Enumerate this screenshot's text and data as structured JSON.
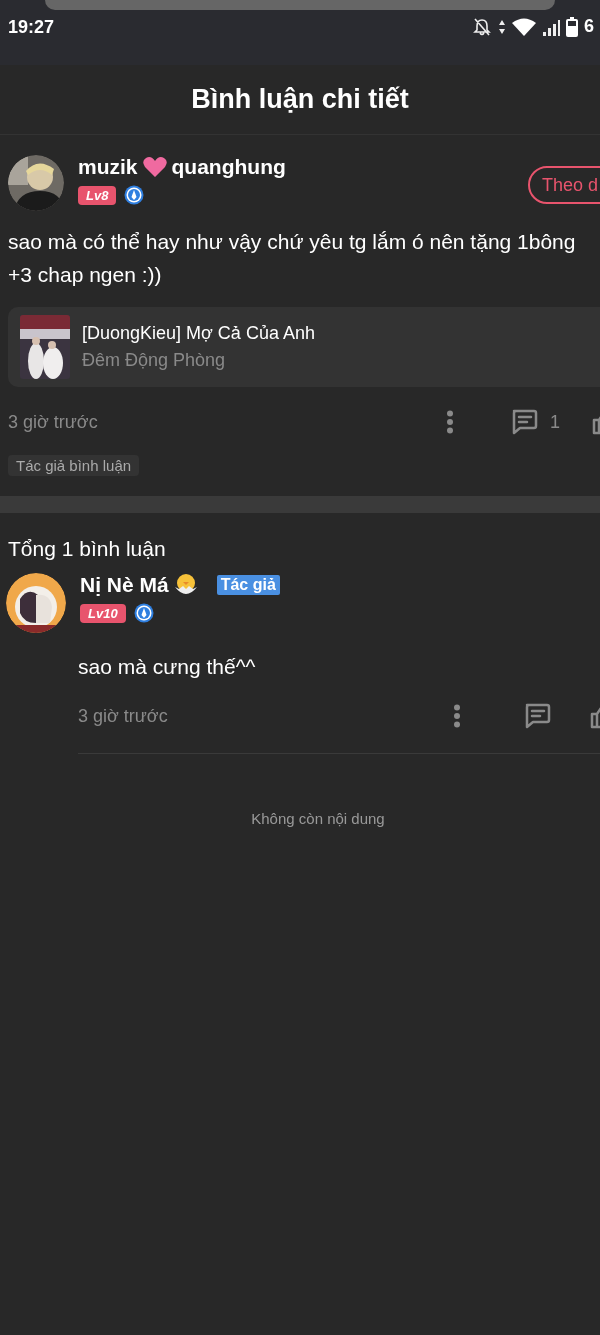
{
  "status_bar": {
    "time": "19:27",
    "battery": "6"
  },
  "header": {
    "title": "Bình luận chi tiết"
  },
  "comment": {
    "author": {
      "name_start": "muzik",
      "name_end": "quanghung",
      "level": "Lv8"
    },
    "follow_button": "Theo d",
    "text": "sao mà có thể hay như vậy chứ yêu tg lắm ó nên tặng 1bông\n+3 chap ngen :))",
    "work": {
      "title": "[DuongKieu] Mợ Cả Của Anh",
      "chapter": "Đêm Động Phòng"
    },
    "time": "3 giờ trước",
    "reply_count": "1",
    "tag": "Tác giả bình luận"
  },
  "replies_heading": "Tổng 1 bình luận",
  "replies": [
    {
      "name": "Nị Nè Má",
      "author_badge": "Tác giả",
      "level": "Lv10",
      "text": "sao mà cưng thế^^",
      "time": "3 giờ trước"
    }
  ],
  "end_note": "Không còn nội dung"
}
